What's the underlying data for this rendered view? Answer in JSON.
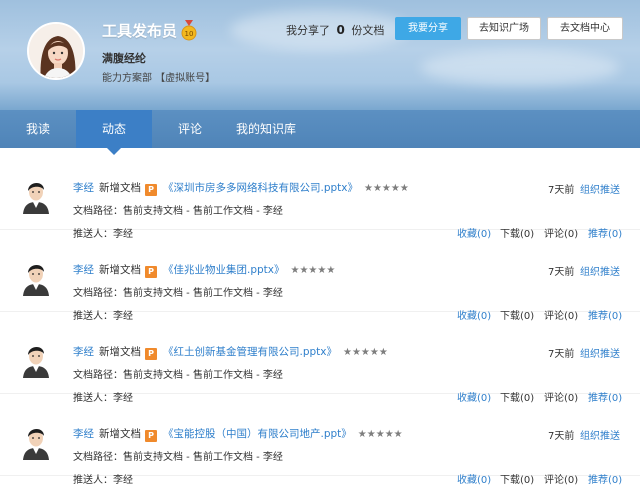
{
  "profile": {
    "name": "工具发布员",
    "level": "10",
    "motto": "满腹经纶",
    "department": "能力方案部 【虚拟账号】",
    "share_prefix": "我分享了",
    "share_count": "0",
    "share_suffix": "份文档"
  },
  "buttons": {
    "share": "我要分享",
    "knowledge_square": "去知识广场",
    "doc_center": "去文档中心"
  },
  "tabs": [
    "我读",
    "动态",
    "评论",
    "我的知识库"
  ],
  "active_tab": "动态",
  "feed": [
    {
      "user": "李经",
      "action": "新增文档",
      "file_type": "P",
      "title": "《深圳市房多多网络科技有限公司.pptx》",
      "stars": "★★★★★",
      "path": "文档路径：售前支持文档 - 售前工作文档 - 李经",
      "pusher": "推送人：李经",
      "time": "7天前",
      "push_action": "组织推送",
      "collect": "收藏(0)",
      "download": "下载(0)",
      "comment": "评论(0)",
      "recommend": "推荐(0)"
    },
    {
      "user": "李经",
      "action": "新增文档",
      "file_type": "P",
      "title": "《佳兆业物业集团.pptx》",
      "stars": "★★★★★",
      "path": "文档路径：售前支持文档 - 售前工作文档 - 李经",
      "pusher": "推送人：李经",
      "time": "7天前",
      "push_action": "组织推送",
      "collect": "收藏(0)",
      "download": "下载(0)",
      "comment": "评论(0)",
      "recommend": "推荐(0)"
    },
    {
      "user": "李经",
      "action": "新增文档",
      "file_type": "P",
      "title": "《红土创新基金管理有限公司.pptx》",
      "stars": "★★★★★",
      "path": "文档路径：售前支持文档 - 售前工作文档 - 李经",
      "pusher": "推送人：李经",
      "time": "7天前",
      "push_action": "组织推送",
      "collect": "收藏(0)",
      "download": "下载(0)",
      "comment": "评论(0)",
      "recommend": "推荐(0)"
    },
    {
      "user": "李经",
      "action": "新增文档",
      "file_type": "P",
      "title": "《宝能控股（中国）有限公司地产.ppt》",
      "stars": "★★★★★",
      "path": "文档路径：售前支持文档 - 售前工作文档 - 李经",
      "pusher": "推送人：李经",
      "time": "7天前",
      "push_action": "组织推送",
      "collect": "收藏(0)",
      "download": "下载(0)",
      "comment": "评论(0)",
      "recommend": "推荐(0)"
    }
  ]
}
